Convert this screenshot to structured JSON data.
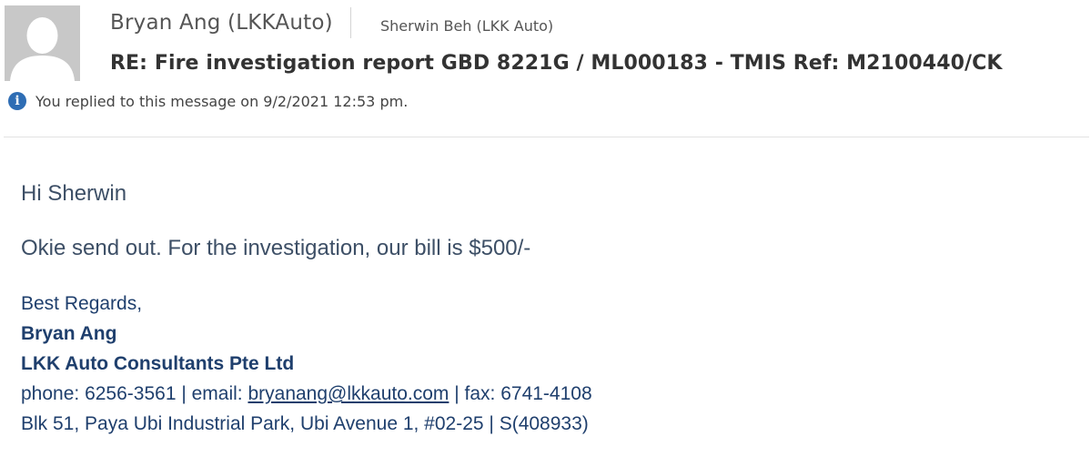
{
  "header": {
    "from": "Bryan Ang (LKKAuto)",
    "to": "Sherwin Beh (LKK Auto)",
    "subject": "RE: Fire investigation report GBD 8221G / ML000183 - TMIS Ref: M2100440/CK",
    "info_text": "You replied to this message on 9/2/2021 12:53 pm.",
    "info_icon": "info-icon",
    "avatar_icon": "person-silhouette-icon"
  },
  "body": {
    "greeting": "Hi Sherwin",
    "message": "Okie send out. For the investigation, our bill is $500/-",
    "signature": {
      "closing": "Best Regards,",
      "name": "Bryan Ang",
      "company": "LKK Auto Consultants Pte Ltd",
      "phone_prefix": "phone: 6256-3561 | email: ",
      "email": "bryanang@lkkauto.com",
      "fax_suffix": " | fax: 6741-4108",
      "address": "Blk 51, Paya Ubi Industrial Park, Ubi Avenue 1, #02-25 | S(408933)"
    }
  },
  "colors": {
    "signature": "#1f3f6d",
    "body_text": "#3d4f66",
    "info_icon": "#2e6db4",
    "avatar_bg": "#c8c8c8"
  }
}
